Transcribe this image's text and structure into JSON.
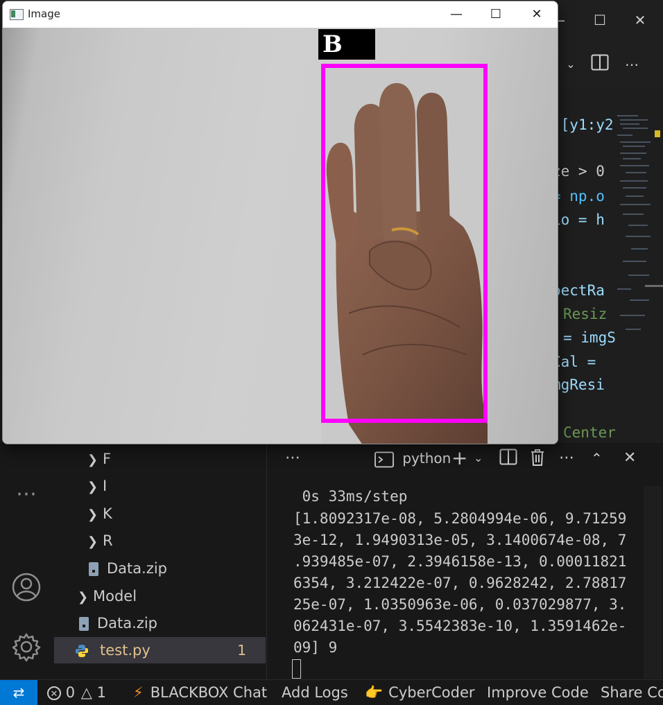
{
  "vscode": {
    "code_fragments": [
      "[y1:y2",
      "ze > 0",
      "= np.o",
      "io = h",
      "pectRa",
      "Resiz",
      "= imgS",
      "Cal = ",
      "mgResi",
      "Center"
    ],
    "explorer": {
      "items": [
        {
          "label": "F",
          "type": "folder",
          "collapsed": true
        },
        {
          "label": "I",
          "type": "folder",
          "collapsed": true
        },
        {
          "label": "K",
          "type": "folder",
          "collapsed": true
        },
        {
          "label": "R",
          "type": "folder",
          "collapsed": true
        },
        {
          "label": "Data.zip",
          "type": "file"
        },
        {
          "label": "Model",
          "type": "folder",
          "collapsed": true
        },
        {
          "label": "Data.zip",
          "type": "file"
        },
        {
          "label": "test.py",
          "type": "python-file",
          "selected": true,
          "problems": "1"
        }
      ]
    },
    "terminal": {
      "shell_label": "python",
      "lines": [
        " 0s 33ms/step",
        "[1.8092317e-08, 5.2804994e-06, 9.71259",
        "3e-12, 1.9490313e-05, 3.1400674e-08, 7",
        ".939485e-07, 2.3946158e-13, 0.00011821",
        "6354, 3.212422e-07, 0.9628242, 2.78817",
        "25e-07, 1.0350963e-06, 0.037029877, 3.",
        "062431e-07, 3.5542383e-10, 1.3591462e-",
        "09] 9"
      ]
    },
    "status_bar": {
      "errors": "0",
      "warnings": "1",
      "items": [
        "BLACKBOX Chat",
        "Add Logs",
        "CyberCoder",
        "Improve Code",
        "Share Co"
      ]
    }
  },
  "image_window": {
    "title": "Image",
    "prediction_label": "B",
    "accent_color": "#ff00ff"
  }
}
